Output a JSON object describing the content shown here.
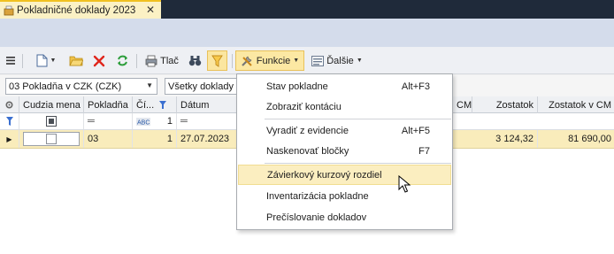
{
  "tab": {
    "title": "Pokladničné doklady 2023",
    "close": "✕"
  },
  "toolbar": {
    "print_label": "Tlač",
    "functions_label": "Funkcie",
    "more_label": "Ďalšie"
  },
  "filters": {
    "cashbox": "03 Pokladňa v CZK (CZK)",
    "documents": "Všetky doklady"
  },
  "grid": {
    "headers": [
      "Cudzia mena",
      "Pokladňa",
      "Čí...",
      "Dátum",
      "CM",
      "Zostatok",
      "Zostatok v CM"
    ],
    "filter_row": {
      "cislo_value": "1",
      "cislo_tag": "ABC"
    },
    "row": {
      "pokladna": "03",
      "cislo": "1",
      "datum": "27.07.2023",
      "zostatok": "3 124,32",
      "zostatok_cm": "81 690,00"
    }
  },
  "menu": {
    "items": [
      {
        "label": "Stav pokladne",
        "shortcut": "Alt+F3"
      },
      {
        "label": "Zobraziť kontáciu",
        "shortcut": ""
      },
      {
        "label": "Vyradiť z evidencie",
        "shortcut": "Alt+F5"
      },
      {
        "label": "Naskenovať bločky",
        "shortcut": "F7"
      },
      {
        "label": "Závierkový kurzový rozdiel",
        "shortcut": ""
      },
      {
        "label": "Inventarizácia pokladne",
        "shortcut": ""
      },
      {
        "label": "Prečíslovanie dokladov",
        "shortcut": ""
      }
    ],
    "highlighted": "Závierkový kurzový rozdiel"
  },
  "colors": {
    "accent": "#fce8a3",
    "selected_row": "#f9ecbb",
    "tab_strip": "#1f2a3a",
    "header_band": "#d4dceb"
  }
}
